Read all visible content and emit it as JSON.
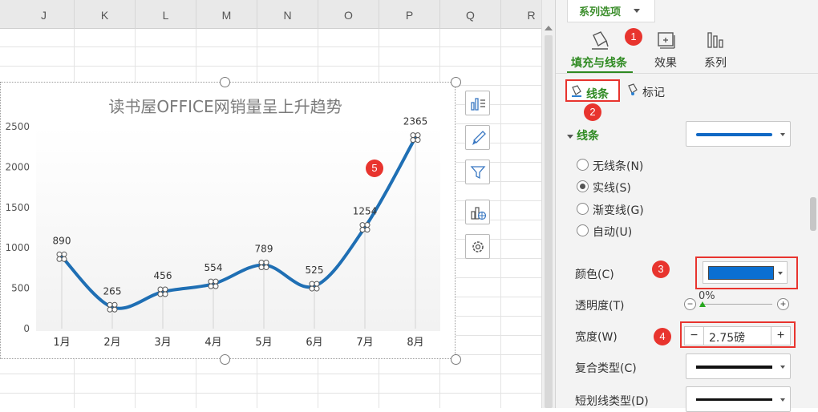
{
  "sheet": {
    "columns": [
      "J",
      "K",
      "L",
      "M",
      "N",
      "O",
      "P",
      "Q",
      "R"
    ]
  },
  "chart_data": {
    "type": "line",
    "title": "读书屋OFFICE网销量呈上升趋势",
    "categories": [
      "1月",
      "2月",
      "3月",
      "4月",
      "5月",
      "6月",
      "7月",
      "8月"
    ],
    "values": [
      890,
      265,
      456,
      554,
      789,
      525,
      1254,
      2365
    ],
    "ylim": [
      0,
      2500
    ],
    "yticks": [
      "0",
      "500",
      "1000",
      "1500",
      "2000",
      "2500"
    ],
    "line_color": "#1f6fb4",
    "smooth": true,
    "grid": false,
    "data_labels": true
  },
  "chart_tools": [
    "chart-elements-icon",
    "chart-style-icon",
    "chart-filter-icon",
    "chart-online-icon",
    "chart-settings-icon"
  ],
  "badges": [
    "1",
    "2",
    "3",
    "4",
    "5"
  ],
  "panel": {
    "dropdown_label": "系列选项",
    "tabs": [
      "填充与线条",
      "效果",
      "系列"
    ],
    "subtabs": {
      "line": "线条",
      "marker": "标记"
    },
    "section_title": "线条",
    "radios": [
      "无线条(N)",
      "实线(S)",
      "渐变线(G)",
      "自动(U)"
    ],
    "selected_radio": "实线(S)",
    "color_label": "颜色(C)",
    "color_value": "#0b6fd1",
    "transparency_label": "透明度(T)",
    "transparency_value": "0%",
    "width_label": "宽度(W)",
    "width_value": "2.75磅",
    "compound_label": "复合类型(C)",
    "dash_label": "短划线类型(D)",
    "accent_color": "#2f8a22",
    "badge_color": "#e8342e"
  }
}
